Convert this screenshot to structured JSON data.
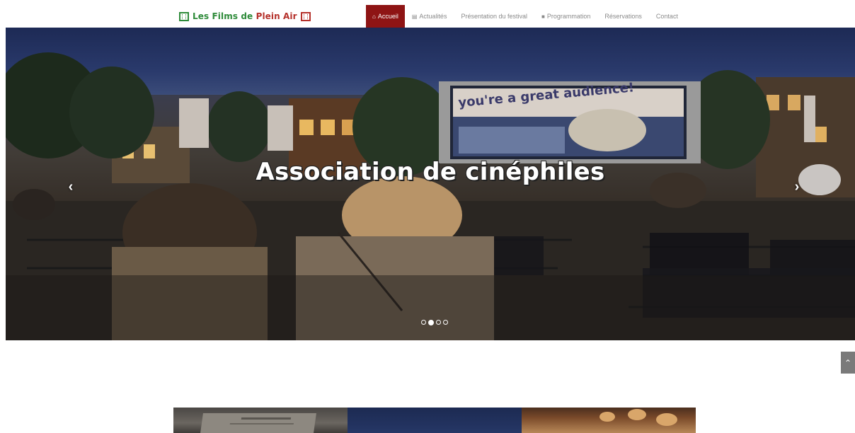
{
  "brand": {
    "part1": "Les Films de ",
    "part2": "Plein Air",
    "colors": {
      "green": "#2e8b3a",
      "red": "#b5312b"
    },
    "icon": "film-icon"
  },
  "nav": {
    "active_color": "#8e1414",
    "items": [
      {
        "label": "Accueil",
        "icon": "home-icon",
        "glyph": "⌂",
        "active": true
      },
      {
        "label": "Actualités",
        "icon": "newspaper-icon",
        "glyph": "▤",
        "active": false
      },
      {
        "label": "Présentation du festival",
        "icon": "",
        "glyph": "",
        "active": false
      },
      {
        "label": "Programmation",
        "icon": "video-camera-icon",
        "glyph": "■",
        "active": false
      },
      {
        "label": "Réservations",
        "icon": "",
        "glyph": "",
        "active": false
      },
      {
        "label": "Contact",
        "icon": "",
        "glyph": "",
        "active": false
      }
    ]
  },
  "carousel": {
    "caption": "Association de cinéphiles",
    "screen_text": "you're a great audience!",
    "prev_glyph": "‹",
    "next_glyph": "›",
    "slide_count": 4,
    "active_slide": 1
  },
  "back_to_top": {
    "glyph": "⌃",
    "icon": "chevron-up-icon"
  }
}
